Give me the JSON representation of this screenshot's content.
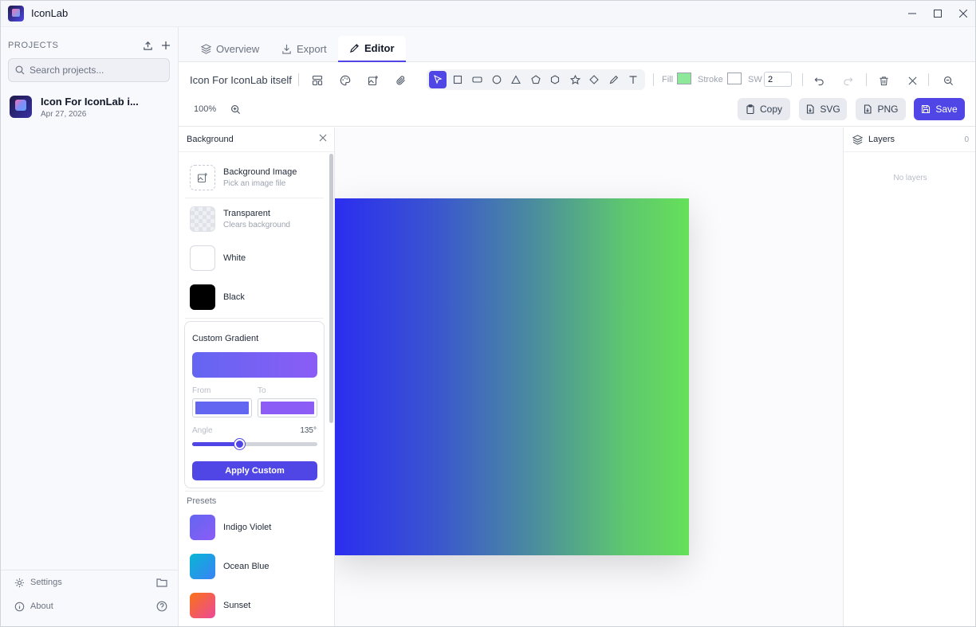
{
  "window": {
    "title": "IconLab",
    "minimize": "—",
    "maximize": "☐",
    "close": "✕"
  },
  "sidebar": {
    "projects_label": "PROJECTS",
    "search_placeholder": "Search projects...",
    "projects": [
      {
        "name": "Icon For IconLab i...",
        "date": "Apr 27, 2026"
      }
    ],
    "settings_label": "Settings",
    "about_label": "About"
  },
  "tabs": [
    {
      "label": "Overview"
    },
    {
      "label": "Export"
    },
    {
      "label": "Editor",
      "active": true
    }
  ],
  "toolbar": {
    "doc_title": "Icon For IconLab itself",
    "fill_label": "Fill",
    "fill_color": "#8ee89a",
    "stroke_label": "Stroke",
    "stroke_color": "#ffffff",
    "sw_label": "SW",
    "sw_value": "2",
    "zoom_level": "100%",
    "copy_label": "Copy",
    "svg_label": "SVG",
    "png_label": "PNG",
    "save_label": "Save",
    "active_tool": "select"
  },
  "background_panel": {
    "title": "Background",
    "image_option": {
      "title": "Background Image",
      "subtitle": "Pick an image file"
    },
    "transparent_option": {
      "title": "Transparent",
      "subtitle": "Clears background"
    },
    "white_option": "White",
    "black_option": "Black",
    "custom": {
      "title": "Custom Gradient",
      "from_label": "From",
      "to_label": "To",
      "from_color": "#6366f1",
      "to_color": "#8b5cf6",
      "angle_label": "Angle",
      "angle_value": "135°",
      "angle": 135,
      "apply_label": "Apply Custom"
    },
    "presets_label": "Presets",
    "presets": [
      {
        "name": "Indigo Violet",
        "from": "#6366f1",
        "to": "#8b5cf6"
      },
      {
        "name": "Ocean Blue",
        "from": "#06b6d4",
        "to": "#3b82f6"
      },
      {
        "name": "Sunset",
        "from": "#f97316",
        "to": "#ec4899"
      }
    ]
  },
  "canvas": {
    "gradient_from": "#2b2df0",
    "gradient_to": "#66e05a"
  },
  "layers": {
    "title": "Layers",
    "count": "0",
    "empty_text": "No layers"
  },
  "colors": {
    "accent": "#4f46e5"
  }
}
